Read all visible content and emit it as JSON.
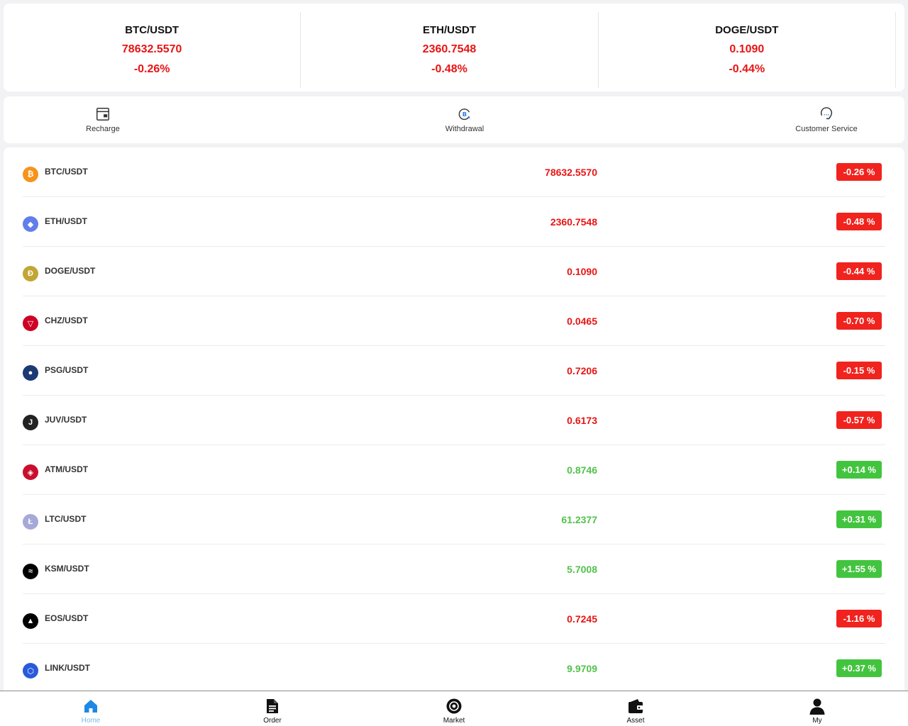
{
  "ticker": [
    {
      "pair": "BTC/USDT",
      "price": "78632.5570",
      "change": "-0.26%"
    },
    {
      "pair": "ETH/USDT",
      "price": "2360.7548",
      "change": "-0.48%"
    },
    {
      "pair": "DOGE/USDT",
      "price": "0.1090",
      "change": "-0.44%"
    }
  ],
  "actions": {
    "recharge": "Recharge",
    "withdrawal": "Withdrawal",
    "customer_service": "Customer Service"
  },
  "colors": {
    "down": "#e81414",
    "up": "#52c24a",
    "badge_down": "#f0231e",
    "badge_up": "#43c43f",
    "nav_active": "#1e88e5"
  },
  "market": [
    {
      "pair": "BTC/USDT",
      "price": "78632.5570",
      "change": "-0.26 %",
      "dir": "down",
      "icon": "bitcoin-icon",
      "glyph": "₿",
      "icon_color": "#f7931a"
    },
    {
      "pair": "ETH/USDT",
      "price": "2360.7548",
      "change": "-0.48 %",
      "dir": "down",
      "icon": "ethereum-icon",
      "glyph": "◆",
      "icon_color": "#627eea"
    },
    {
      "pair": "DOGE/USDT",
      "price": "0.1090",
      "change": "-0.44 %",
      "dir": "down",
      "icon": "dogecoin-icon",
      "glyph": "Ð",
      "icon_color": "#c2a633"
    },
    {
      "pair": "CHZ/USDT",
      "price": "0.0465",
      "change": "-0.70 %",
      "dir": "down",
      "icon": "chiliz-icon",
      "glyph": "▽",
      "icon_color": "#cd0124"
    },
    {
      "pair": "PSG/USDT",
      "price": "0.7206",
      "change": "-0.15 %",
      "dir": "down",
      "icon": "psg-icon",
      "glyph": "●",
      "icon_color": "#1b3a74"
    },
    {
      "pair": "JUV/USDT",
      "price": "0.6173",
      "change": "-0.57 %",
      "dir": "down",
      "icon": "juventus-icon",
      "glyph": "J",
      "icon_color": "#222222"
    },
    {
      "pair": "ATM/USDT",
      "price": "0.8746",
      "change": "+0.14 %",
      "dir": "up",
      "icon": "atletico-icon",
      "glyph": "◈",
      "icon_color": "#c8102e"
    },
    {
      "pair": "LTC/USDT",
      "price": "61.2377",
      "change": "+0.31 %",
      "dir": "up",
      "icon": "litecoin-icon",
      "glyph": "Ł",
      "icon_color": "#a6a9d8"
    },
    {
      "pair": "KSM/USDT",
      "price": "5.7008",
      "change": "+1.55 %",
      "dir": "up",
      "icon": "kusama-icon",
      "glyph": "≈",
      "icon_color": "#000000"
    },
    {
      "pair": "EOS/USDT",
      "price": "0.7245",
      "change": "-1.16 %",
      "dir": "down",
      "icon": "eos-icon",
      "glyph": "▲",
      "icon_color": "#000000"
    },
    {
      "pair": "LINK/USDT",
      "price": "9.9709",
      "change": "+0.37 %",
      "dir": "up",
      "icon": "chainlink-icon",
      "glyph": "⬡",
      "icon_color": "#2a5ada"
    }
  ],
  "nav": {
    "home": "Home",
    "order": "Order",
    "market": "Market",
    "asset": "Asset",
    "my": "My"
  }
}
